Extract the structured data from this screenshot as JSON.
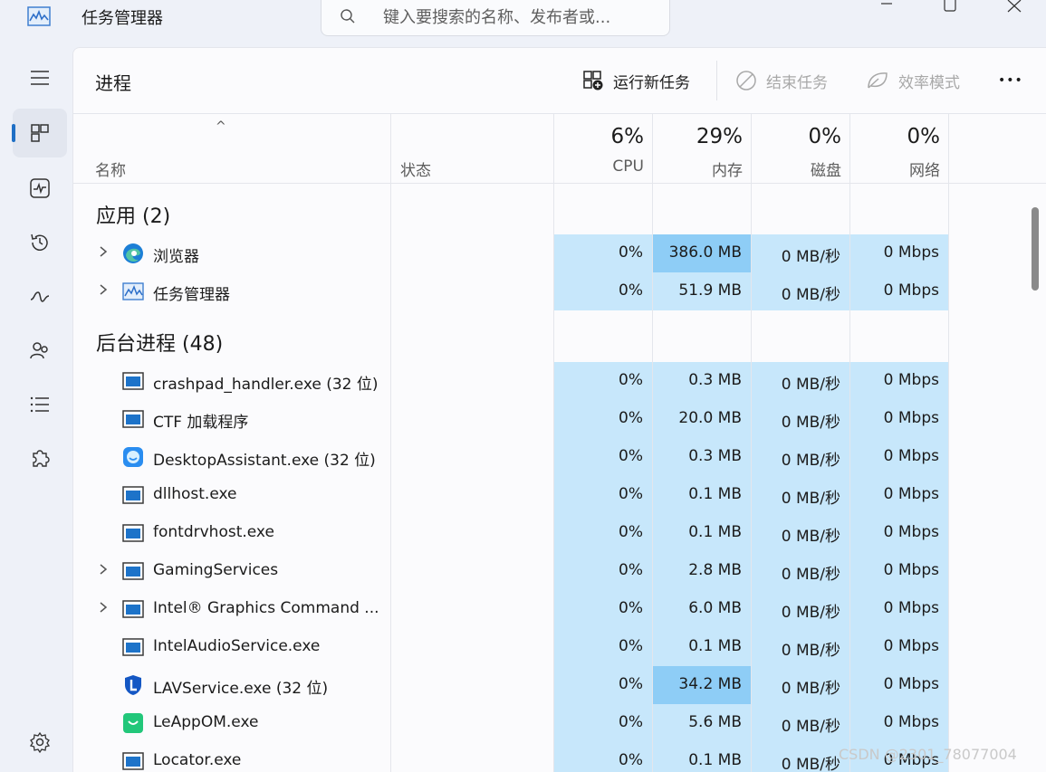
{
  "app": {
    "title": "任务管理器"
  },
  "search": {
    "placeholder": "键入要搜索的名称、发布者或..."
  },
  "toolbar": {
    "page_title": "进程",
    "run_new_task": "运行新任务",
    "end_task": "结束任务",
    "efficiency_mode": "效率模式",
    "more": "•••"
  },
  "header": {
    "name": "名称",
    "status": "状态",
    "cpu_pct": "6%",
    "cpu": "CPU",
    "mem_pct": "29%",
    "mem": "内存",
    "disk_pct": "0%",
    "disk": "磁盘",
    "net_pct": "0%",
    "net": "网络"
  },
  "groups": {
    "apps": "应用 (2)",
    "background": "后台进程 (48)"
  },
  "apps": [
    {
      "name": "浏览器",
      "icon": "edge-icon",
      "cpu": "0%",
      "mem": "386.0 MB",
      "disk": "0 MB/秒",
      "net": "0 Mbps",
      "expandable": true,
      "hot": true
    },
    {
      "name": "任务管理器",
      "icon": "task-manager-icon",
      "cpu": "0%",
      "mem": "51.9 MB",
      "disk": "0 MB/秒",
      "net": "0 Mbps",
      "expandable": true,
      "hot": false
    }
  ],
  "background": [
    {
      "name": "crashpad_handler.exe (32 位)",
      "icon": "window-icon",
      "cpu": "0%",
      "mem": "0.3 MB",
      "disk": "0 MB/秒",
      "net": "0 Mbps",
      "expandable": false,
      "hot": false
    },
    {
      "name": "CTF 加载程序",
      "icon": "window-icon",
      "cpu": "0%",
      "mem": "20.0 MB",
      "disk": "0 MB/秒",
      "net": "0 Mbps",
      "expandable": false,
      "hot": false
    },
    {
      "name": "DesktopAssistant.exe (32 位)",
      "icon": "assistant-icon",
      "cpu": "0%",
      "mem": "0.3 MB",
      "disk": "0 MB/秒",
      "net": "0 Mbps",
      "expandable": false,
      "hot": false
    },
    {
      "name": "dllhost.exe",
      "icon": "window-icon",
      "cpu": "0%",
      "mem": "0.1 MB",
      "disk": "0 MB/秒",
      "net": "0 Mbps",
      "expandable": false,
      "hot": false
    },
    {
      "name": "fontdrvhost.exe",
      "icon": "window-icon",
      "cpu": "0%",
      "mem": "0.1 MB",
      "disk": "0 MB/秒",
      "net": "0 Mbps",
      "expandable": false,
      "hot": false
    },
    {
      "name": "GamingServices",
      "icon": "window-icon",
      "cpu": "0%",
      "mem": "2.8 MB",
      "disk": "0 MB/秒",
      "net": "0 Mbps",
      "expandable": true,
      "hot": false
    },
    {
      "name": "Intel® Graphics Command ...",
      "icon": "window-icon",
      "cpu": "0%",
      "mem": "6.0 MB",
      "disk": "0 MB/秒",
      "net": "0 Mbps",
      "expandable": true,
      "hot": false
    },
    {
      "name": "IntelAudioService.exe",
      "icon": "window-icon",
      "cpu": "0%",
      "mem": "0.1 MB",
      "disk": "0 MB/秒",
      "net": "0 Mbps",
      "expandable": false,
      "hot": false
    },
    {
      "name": "LAVService.exe (32 位)",
      "icon": "shield-icon",
      "cpu": "0%",
      "mem": "34.2 MB",
      "disk": "0 MB/秒",
      "net": "0 Mbps",
      "expandable": false,
      "hot": true
    },
    {
      "name": "LeAppOM.exe",
      "icon": "bag-icon",
      "cpu": "0%",
      "mem": "5.6 MB",
      "disk": "0 MB/秒",
      "net": "0 Mbps",
      "expandable": false,
      "hot": false
    },
    {
      "name": "Locator.exe",
      "icon": "window-icon",
      "cpu": "0%",
      "mem": "0.1 MB",
      "disk": "0 MB/秒",
      "net": "0 Mbps",
      "expandable": false,
      "hot": false
    }
  ],
  "watermark": "CSDN @2301_78077004",
  "colors": {
    "accent": "#1f6fc5",
    "cell": "#c7e7fb",
    "cell_hot": "#8ecdf6"
  }
}
